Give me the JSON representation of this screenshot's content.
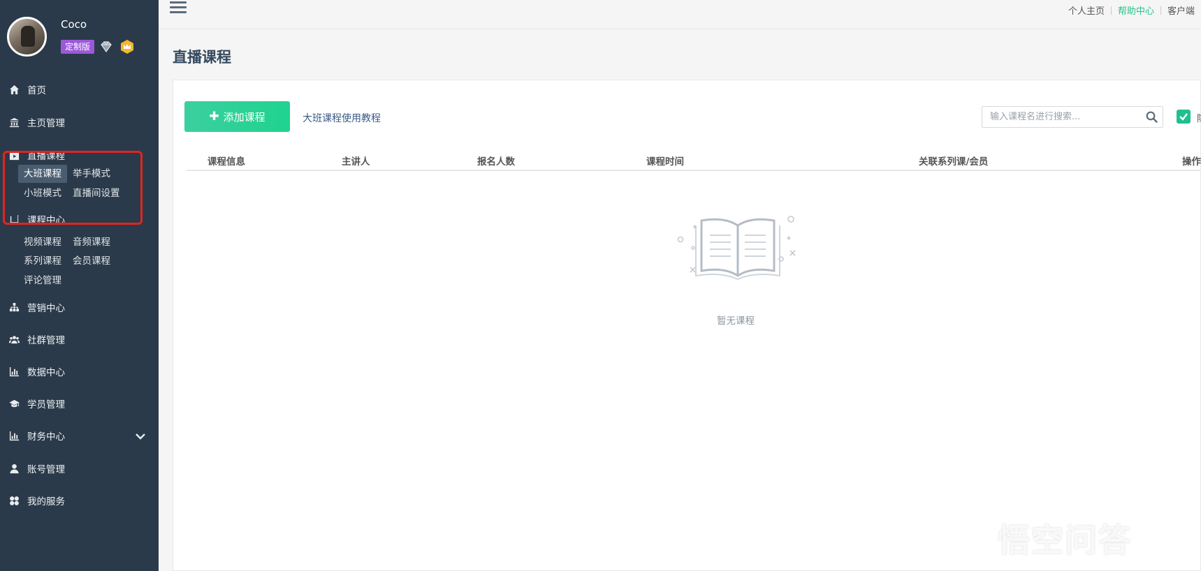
{
  "profile": {
    "username": "Coco",
    "badge": "定制版"
  },
  "nav": {
    "home": "首页",
    "homepage_mgmt": "主页管理",
    "live": {
      "label": "直播课程",
      "sub": [
        "大班课程",
        "举手模式",
        "小班模式",
        "直播间设置"
      ]
    },
    "course_center": {
      "label": "课程中心",
      "sub": [
        "视频课程",
        "音频课程",
        "系列课程",
        "会员课程",
        "评论管理"
      ]
    },
    "marketing": "营销中心",
    "community": "社群管理",
    "data": "数据中心",
    "students": "学员管理",
    "finance": "财务中心",
    "account": "账号管理",
    "services": "我的服务"
  },
  "topbar": {
    "links": [
      "个人主页",
      "帮助中心",
      "客户端"
    ]
  },
  "page": {
    "title": "直播课程"
  },
  "toolbar": {
    "add_course": "添加课程",
    "tutorial": "大班课程使用教程",
    "search_placeholder": "输入课程名进行搜索...",
    "checkbox_label": "隐"
  },
  "table": {
    "headers": [
      "课程信息",
      "主讲人",
      "报名人数",
      "课程时间",
      "关联系列课/会员",
      "操作"
    ]
  },
  "empty": {
    "text": "暂无课程"
  },
  "watermark": "悟空问答",
  "colors": {
    "sidebar": "#2b3a4a",
    "accent": "#1fd38e",
    "highlight": "#e0251f"
  }
}
